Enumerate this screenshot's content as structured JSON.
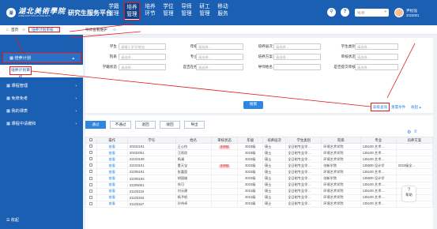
{
  "header": {
    "logo_glyph": "湖",
    "school": "湖北美術學院",
    "school_en": "HUBEI INSTITUTE OF FINE ARTS",
    "platform": "研究生服务平台",
    "nav": [
      {
        "l1": "学籍",
        "l2": "管理"
      },
      {
        "l1": "培养",
        "l2": "管理"
      },
      {
        "l1": "培养",
        "l2": "环节"
      },
      {
        "l1": "学位",
        "l2": "管理"
      },
      {
        "l1": "导师",
        "l2": "管理"
      },
      {
        "l1": "研工",
        "l2": "管理"
      },
      {
        "l1": "移动",
        "l2": "服务"
      }
    ],
    "search_icon": "search-icon",
    "help_glyph": "?",
    "select_value": "导师",
    "user_name": "尹松强",
    "user_id": "2023001"
  },
  "tabbar": {
    "home": "首页",
    "home_close": "⊙",
    "current": "培养计划审核",
    "current_close": "⊙",
    "second": "导师查看维护",
    "second_close": "⊙"
  },
  "sidebar": {
    "group": "培养计划",
    "sub": "培养计划审核",
    "items": [
      {
        "label": "课程管理"
      },
      {
        "label": "免修免考"
      },
      {
        "label": "我的课表"
      },
      {
        "label": "课程中请缓和"
      }
    ],
    "foot": "收起"
  },
  "filters": {
    "row1": [
      {
        "label": "学生",
        "placeholder": "请输入学号/姓名"
      },
      {
        "label": "年级",
        "placeholder": "请选择..."
      },
      {
        "label": "培养层次",
        "placeholder": "请选择..."
      },
      {
        "label": "学生类别",
        "placeholder": "请选择..."
      }
    ],
    "row2": [
      {
        "label": "院系",
        "placeholder": "请选择..."
      },
      {
        "label": "专业",
        "placeholder": "请选择..."
      },
      {
        "label": "培养方案",
        "placeholder": "请选择..."
      },
      {
        "label": "审核状态",
        "placeholder": "请选择..."
      }
    ],
    "row3": [
      {
        "label": "学籍状态",
        "placeholder": "请选择..."
      },
      {
        "label": "是否在校",
        "placeholder": "请选择..."
      },
      {
        "label": "导师姓名",
        "placeholder": ""
      },
      {
        "label": "是否提交审核",
        "placeholder": "请选择..."
      }
    ],
    "search_btn": "搜索",
    "advanced": "高级查询",
    "reset": "重置条件",
    "collapse": "收起 ▴"
  },
  "tabs": [
    "通过",
    "不通过",
    "退回",
    "收回",
    "导出"
  ],
  "settings_icon": "gear-icon",
  "table": {
    "headers": [
      "",
      "操作",
      "学号",
      "姓名",
      "审核状态",
      "年级",
      "培养层次",
      "学生类别",
      "院系",
      "专业",
      "培养方案"
    ],
    "rows": [
      {
        "op": "查看",
        "id": "20232191",
        "name": "王心怡",
        "tag": "未审核",
        "grade": "2023级",
        "level": "硕士",
        "type": "全日制专业学...",
        "dept": "环境艺术学院",
        "major": "135100 艺术...",
        "plan": ""
      },
      {
        "op": "查看",
        "id": "20232051",
        "name": "汪雨欣",
        "tag": "",
        "grade": "2023级",
        "level": "硕士",
        "type": "全日制专业学...",
        "dept": "环境艺术学院",
        "major": "135100 艺术...",
        "plan": ""
      },
      {
        "op": "查看",
        "id": "22103108",
        "name": "杨澜",
        "tag": "",
        "grade": "2022级",
        "level": "硕士",
        "type": "全日制专业学...",
        "dept": "环境艺术学院",
        "major": "135100 艺术...",
        "plan": ""
      },
      {
        "op": "查看",
        "id": "22103101",
        "name": "董天宝",
        "tag": "未审核",
        "grade": "2022级",
        "level": "硕士",
        "type": "全日制专业学...",
        "dept": "创新学院",
        "major": "135500 设计学",
        "plan": "2022级全..."
      },
      {
        "op": "查看",
        "id": "22205191",
        "name": "张嘉茵",
        "tag": "",
        "grade": "2022级",
        "level": "硕士",
        "type": "全日制专业学...",
        "dept": "环境艺术学院",
        "major": "135100 艺术...",
        "plan": ""
      },
      {
        "op": "查看",
        "id": "22205192",
        "name": "胡国雄",
        "tag": "",
        "grade": "2022级",
        "level": "硕士",
        "type": "全日制专业学...",
        "dept": "创新学院",
        "major": "135500 设计学",
        "plan": ""
      },
      {
        "op": "查看",
        "id": "22205051",
        "name": "徐可",
        "tag": "",
        "grade": "2022级",
        "level": "硕士",
        "type": "全日制专业学...",
        "dept": "环境艺术学院",
        "major": "135100 艺术...",
        "plan": ""
      },
      {
        "op": "查看",
        "id": "21103133",
        "name": "刘元建",
        "tag": "",
        "grade": "2021级",
        "level": "硕士",
        "type": "全日制专业学...",
        "dept": "环境艺术学院",
        "major": "135100 艺术...",
        "plan": ""
      },
      {
        "op": "查看",
        "id": "21103153",
        "name": "杨予帆",
        "tag": "",
        "grade": "2021级",
        "level": "硕士",
        "type": "全日制专业学...",
        "dept": "环境艺术学院",
        "major": "135100 艺术...",
        "plan": ""
      },
      {
        "op": "查看",
        "id": "21103157",
        "name": "孙伟卓",
        "tag": "",
        "grade": "2021级",
        "level": "硕士",
        "type": "全日制专业学...",
        "dept": "环境艺术学院",
        "major": "135100 艺术...",
        "plan": ""
      }
    ]
  },
  "help": {
    "icon": "?",
    "label": "帮助"
  },
  "colors": {
    "primary": "#1b5fb3",
    "accent": "#2e86de",
    "highlight": "#e31818"
  }
}
